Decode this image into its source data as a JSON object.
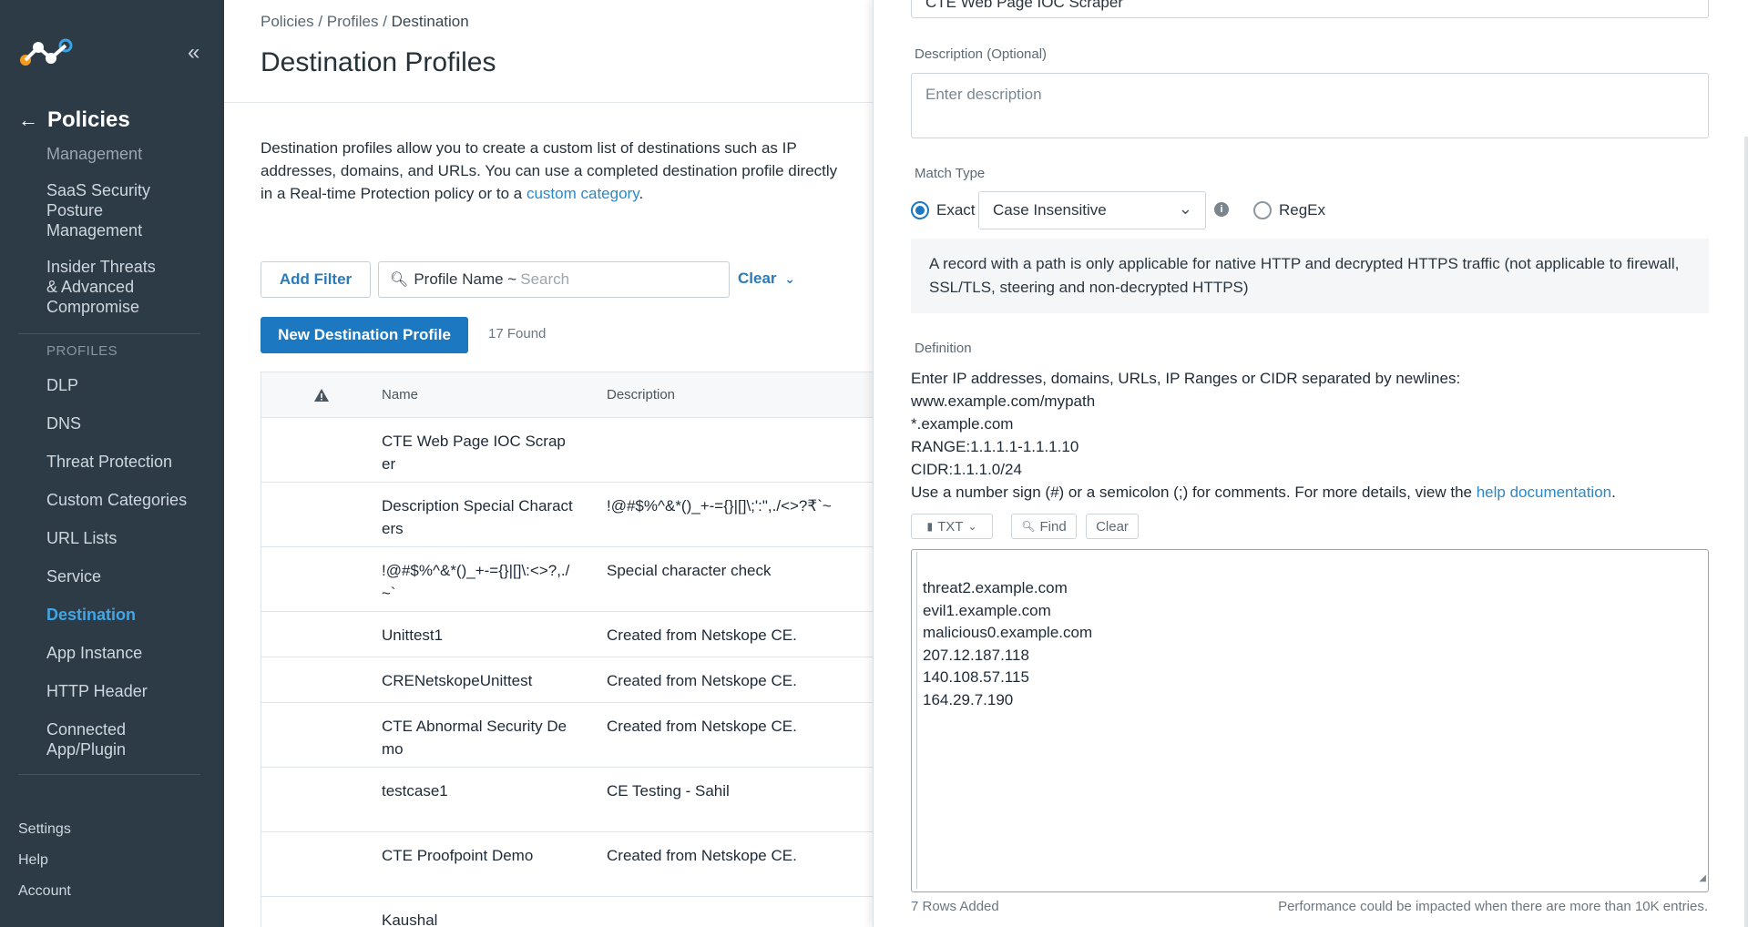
{
  "sidebar": {
    "back_label": "Policies",
    "items": [
      {
        "label": "Management",
        "state": "faded"
      },
      {
        "label": "SaaS Security Posture Management",
        "state": ""
      },
      {
        "label": "Insider Threats & Advanced Compromise",
        "state": ""
      }
    ],
    "section_profiles": "PROFILES",
    "profile_items": [
      {
        "label": "DLP",
        "state": ""
      },
      {
        "label": "DNS",
        "state": ""
      },
      {
        "label": "Threat Protection",
        "state": ""
      },
      {
        "label": "Custom Categories",
        "state": ""
      },
      {
        "label": "URL Lists",
        "state": ""
      },
      {
        "label": "Service",
        "state": ""
      },
      {
        "label": "Destination",
        "state": "active"
      },
      {
        "label": "App Instance",
        "state": ""
      },
      {
        "label": "HTTP Header",
        "state": ""
      },
      {
        "label": "Connected App/Plugin",
        "state": ""
      }
    ],
    "bottom_items": [
      "Settings",
      "Help",
      "Account"
    ]
  },
  "main": {
    "breadcrumb_1": "Policies",
    "breadcrumb_2": "Profiles",
    "breadcrumb_3": "Destination",
    "title": "Destination Profiles",
    "intro_text": "Destination profiles allow you to create a custom list of destinations such as IP addresses, domains, and URLs. You can use a completed destination profile directly in a Real-time Protection policy or to a ",
    "intro_link": "custom category",
    "intro_end": ".",
    "add_filter": "Add Filter",
    "search_field": "Profile Name ~",
    "search_placeholder": "Search",
    "clear": "Clear",
    "new_profile": "New Destination Profile",
    "found": "17 Found",
    "table": {
      "headers": [
        "Name",
        "Description"
      ],
      "rows": [
        {
          "name": "CTE Web Page IOC Scraper",
          "desc": ""
        },
        {
          "name": "Description Special Characters",
          "desc": "!@#$%^&*()_+-={}|[]\\;':\",./<>?₹`~"
        },
        {
          "name": "!@#$%^&*()_+-={}|[]\\:<>?,./~`",
          "desc": "Special character check"
        },
        {
          "name": "Unittest1",
          "desc": "Created from Netskope CE."
        },
        {
          "name": "CRENetskopeUnittest",
          "desc": "Created from Netskope CE."
        },
        {
          "name": "CTE Abnormal Security Demo",
          "desc": "Created from Netskope CE."
        },
        {
          "name": "testcase1",
          "desc": "CE Testing - Sahil"
        },
        {
          "name": "CTE Proofpoint Demo",
          "desc": "Created from Netskope CE."
        },
        {
          "name": "Kaushal",
          "desc": ""
        }
      ]
    }
  },
  "panel": {
    "name_value": "CTE Web Page IOC Scraper",
    "desc_label": "Description (Optional)",
    "desc_placeholder": "Enter description",
    "match_label": "Match Type",
    "exact": "Exact",
    "case_option": "Case Insensitive",
    "regex": "RegEx",
    "note": "A record with a path is only applicable for native HTTP and decrypted HTTPS traffic (not applicable to firewall, SSL/TLS, steering and non-decrypted HTTPS)",
    "definition_label": "Definition",
    "def_lines": [
      "Enter IP addresses, domains, URLs, IP Ranges or CIDR separated by newlines:",
      "www.example.com/mypath",
      "*.example.com",
      "RANGE:1.1.1.1-1.1.1.10",
      "CIDR:1.1.1.0/24"
    ],
    "def_comment": "Use a number sign (#) or a semicolon (;) for comments. For more details, view the ",
    "def_link": "help documentation",
    "def_end": ".",
    "txt_btn": "TXT",
    "find_btn": "Find",
    "clear_btn": "Clear",
    "entries": [
      "threat2.example.com",
      "evil1.example.com",
      "malicious0.example.com",
      "207.12.187.118",
      "140.108.57.115",
      "164.29.7.190"
    ],
    "rows_added": "7 Rows Added",
    "perf_note": "Performance could be impacted when there are more than 10K entries."
  }
}
